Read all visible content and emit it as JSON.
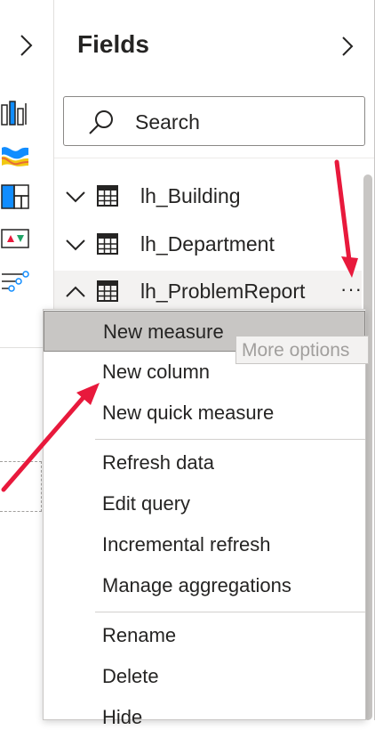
{
  "fields_pane": {
    "title": "Fields",
    "search": {
      "label": "Search"
    }
  },
  "tables": [
    {
      "name": "lh_Building",
      "expanded": false
    },
    {
      "name": "lh_Department",
      "expanded": false
    },
    {
      "name": "lh_ProblemReport",
      "expanded": true,
      "more_label": "···"
    }
  ],
  "context_menu": {
    "groups": [
      [
        "New measure",
        "New column",
        "New quick measure"
      ],
      [
        "Refresh data",
        "Edit query",
        "Incremental refresh",
        "Manage aggregations"
      ],
      [
        "Rename",
        "Delete",
        "Hide"
      ]
    ]
  },
  "tooltip": {
    "text": "More options"
  },
  "colors": {
    "accent_arrow": "#e8193c",
    "selection": "#c8c6c4",
    "icon_blue": "#118dff"
  }
}
